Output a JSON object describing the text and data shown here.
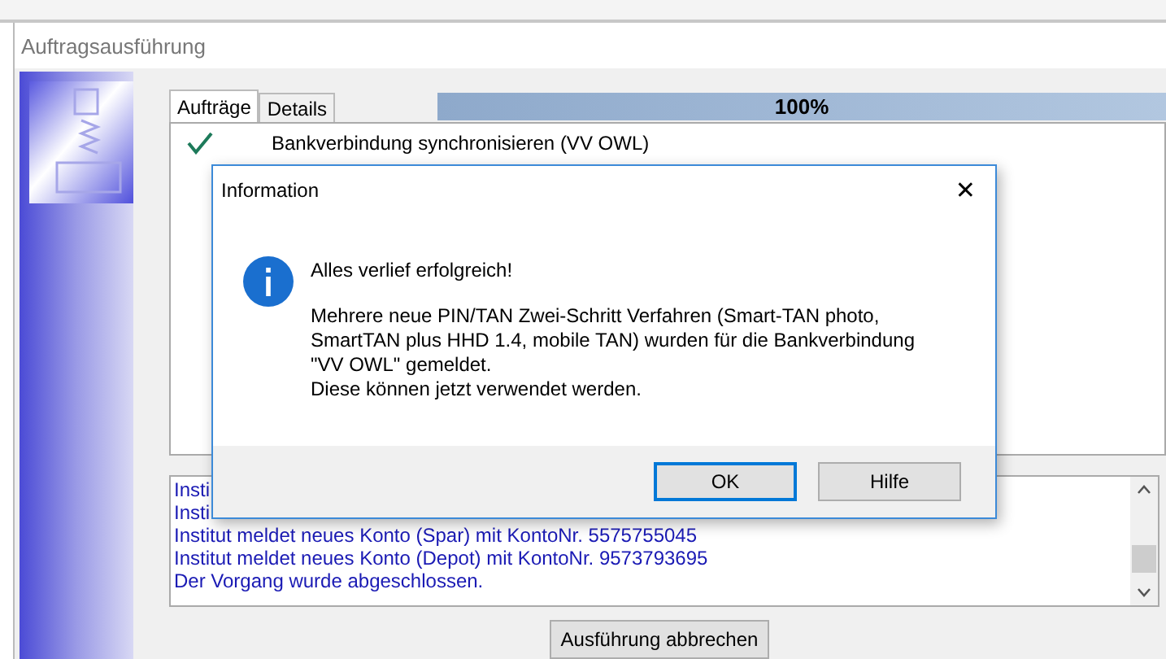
{
  "window": {
    "title": "Auftragsausführung"
  },
  "tabs": [
    {
      "label": "Aufträge",
      "selected": true
    },
    {
      "label": "Details",
      "selected": false
    }
  ],
  "progress": {
    "level": 1,
    "reading": "100%"
  },
  "tasks": [
    {
      "label": "Bankverbindung synchronisieren (VV OWL)",
      "done": true
    }
  ],
  "log": [
    "Insti",
    "Insti",
    "Institut meldet neues Konto (Spar) mit KontoNr. 5575755045",
    "Institut meldet neues Konto (Depot) mit KontoNr. 9573793695",
    "Der Vorgang wurde abgeschlossen."
  ],
  "cancel_button": "Ausführung abbrechen",
  "dialog": {
    "title": "Information",
    "close": "✕",
    "heading": "Alles verlief erfolgreich!",
    "message": [
      "Mehrere neue PIN/TAN Zwei-Schritt Verfahren (Smart-TAN photo,",
      "SmartTAN plus HHD 1.4, mobile TAN) wurden für die Bankverbindung",
      "\"VV OWL\" gemeldet.",
      "Diese können jetzt verwendet werden."
    ],
    "buttons": [
      {
        "label": "OK",
        "default": true
      },
      {
        "label": "Hilfe",
        "default": false
      }
    ]
  }
}
